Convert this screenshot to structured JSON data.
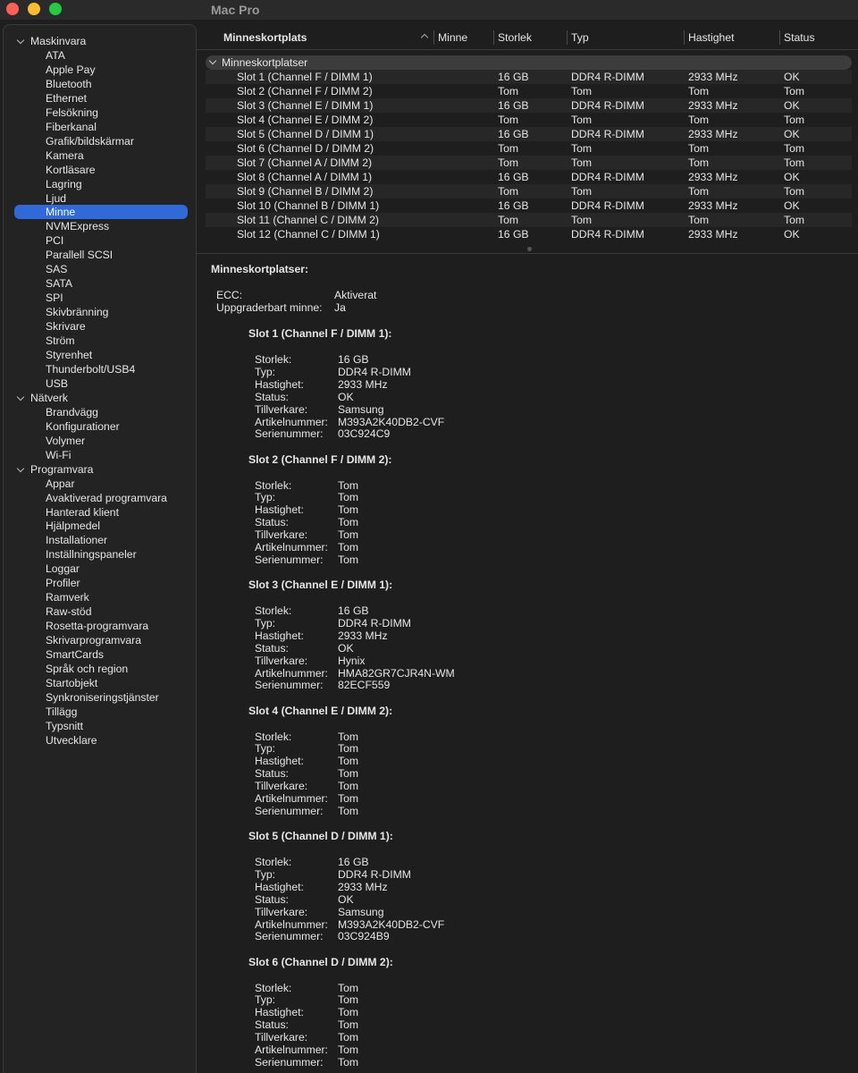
{
  "window": {
    "title": "Mac Pro"
  },
  "sidebar": {
    "groups": [
      {
        "label": "Maskinvara",
        "items": [
          "ATA",
          "Apple Pay",
          "Bluetooth",
          "Ethernet",
          "Felsökning",
          "Fiberkanal",
          "Grafik/bildskärmar",
          "Kamera",
          "Kortläsare",
          "Lagring",
          "Ljud",
          "Minne",
          "NVMExpress",
          "PCI",
          "Parallell SCSI",
          "SAS",
          "SATA",
          "SPI",
          "Skivbränning",
          "Skrivare",
          "Ström",
          "Styrenhet",
          "Thunderbolt/USB4",
          "USB"
        ]
      },
      {
        "label": "Nätverk",
        "items": [
          "Brandvägg",
          "Konfigurationer",
          "Volymer",
          "Wi-Fi"
        ]
      },
      {
        "label": "Programvara",
        "items": [
          "Appar",
          "Avaktiverad programvara",
          "Hanterad klient",
          "Hjälpmedel",
          "Installationer",
          "Inställningspaneler",
          "Loggar",
          "Profiler",
          "Ramverk",
          "Raw-stöd",
          "Rosetta-programvara",
          "Skrivarprogramvara",
          "SmartCards",
          "Språk och region",
          "Startobjekt",
          "Synkroniseringstjänster",
          "Tillägg",
          "Typsnitt",
          "Utvecklare"
        ]
      }
    ],
    "selected": "Minne"
  },
  "table": {
    "columns": [
      "Minneskortplats",
      "Minne",
      "Storlek",
      "Typ",
      "Hastighet",
      "Status"
    ],
    "group_label": "Minneskortplatser",
    "rows": [
      [
        "Slot 1 (Channel F / DIMM 1)",
        "16 GB",
        "DDR4 R-DIMM",
        "2933 MHz",
        "OK"
      ],
      [
        "Slot 2 (Channel F / DIMM 2)",
        "Tom",
        "Tom",
        "Tom",
        "Tom"
      ],
      [
        "Slot 3 (Channel E / DIMM 1)",
        "16 GB",
        "DDR4 R-DIMM",
        "2933 MHz",
        "OK"
      ],
      [
        "Slot 4 (Channel E / DIMM 2)",
        "Tom",
        "Tom",
        "Tom",
        "Tom"
      ],
      [
        "Slot 5 (Channel D / DIMM 1)",
        "16 GB",
        "DDR4 R-DIMM",
        "2933 MHz",
        "OK"
      ],
      [
        "Slot 6 (Channel D / DIMM 2)",
        "Tom",
        "Tom",
        "Tom",
        "Tom"
      ],
      [
        "Slot 7 (Channel A / DIMM 2)",
        "Tom",
        "Tom",
        "Tom",
        "Tom"
      ],
      [
        "Slot 8 (Channel A / DIMM 1)",
        "16 GB",
        "DDR4 R-DIMM",
        "2933 MHz",
        "OK"
      ],
      [
        "Slot 9 (Channel B / DIMM 2)",
        "Tom",
        "Tom",
        "Tom",
        "Tom"
      ],
      [
        "Slot 10 (Channel B / DIMM 1)",
        "16 GB",
        "DDR4 R-DIMM",
        "2933 MHz",
        "OK"
      ],
      [
        "Slot 11 (Channel C / DIMM 2)",
        "Tom",
        "Tom",
        "Tom",
        "Tom"
      ],
      [
        "Slot 12 (Channel C / DIMM 1)",
        "16 GB",
        "DDR4 R-DIMM",
        "2933 MHz",
        "OK"
      ]
    ]
  },
  "details": {
    "heading": "Minneskortplatser:",
    "summary": [
      {
        "label": "ECC:",
        "value": "Aktiverat"
      },
      {
        "label": "Uppgraderbart minne:",
        "value": "Ja"
      }
    ],
    "field_labels": [
      "Storlek:",
      "Typ:",
      "Hastighet:",
      "Status:",
      "Tillverkare:",
      "Artikelnummer:",
      "Serienummer:"
    ],
    "slots": [
      {
        "title": "Slot 1 (Channel F / DIMM 1):",
        "values": [
          "16 GB",
          "DDR4 R-DIMM",
          "2933 MHz",
          "OK",
          "Samsung",
          "M393A2K40DB2-CVF",
          "03C924C9"
        ]
      },
      {
        "title": "Slot 2 (Channel F / DIMM 2):",
        "values": [
          "Tom",
          "Tom",
          "Tom",
          "Tom",
          "Tom",
          "Tom",
          "Tom"
        ]
      },
      {
        "title": "Slot 3 (Channel E / DIMM 1):",
        "values": [
          "16 GB",
          "DDR4 R-DIMM",
          "2933 MHz",
          "OK",
          "Hynix",
          "HMA82GR7CJR4N-WM",
          "82ECF559"
        ]
      },
      {
        "title": "Slot 4 (Channel E / DIMM 2):",
        "values": [
          "Tom",
          "Tom",
          "Tom",
          "Tom",
          "Tom",
          "Tom",
          "Tom"
        ]
      },
      {
        "title": "Slot 5 (Channel D / DIMM 1):",
        "values": [
          "16 GB",
          "DDR4 R-DIMM",
          "2933 MHz",
          "OK",
          "Samsung",
          "M393A2K40DB2-CVF",
          "03C924B9"
        ]
      },
      {
        "title": "Slot 6 (Channel D / DIMM 2):",
        "values": [
          "Tom",
          "Tom",
          "Tom",
          "Tom",
          "Tom",
          "Tom",
          "Tom"
        ]
      }
    ]
  }
}
